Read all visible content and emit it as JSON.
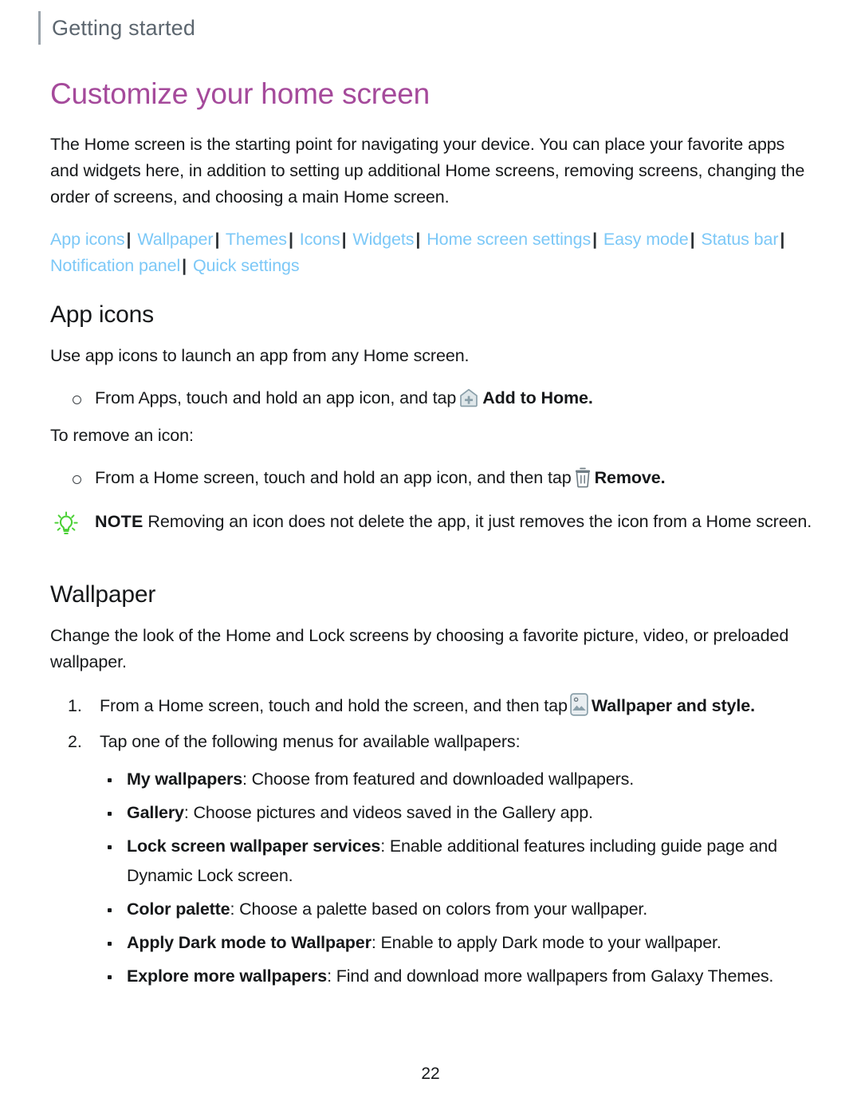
{
  "header": {
    "running_title": "Getting started"
  },
  "page_title": "Customize your home screen",
  "intro": "The Home screen is the starting point for navigating your device. You can place your favorite apps and widgets here, in addition to setting up additional Home screens, removing screens, changing the order of screens, and choosing a main Home screen.",
  "cross_links": [
    "App icons",
    "Wallpaper",
    "Themes",
    "Icons",
    "Widgets",
    "Home screen settings",
    "Easy mode",
    "Status bar",
    "Notification panel",
    "Quick settings"
  ],
  "link_separator": "|",
  "sections": {
    "app_icons": {
      "heading": "App icons",
      "intro": "Use app icons to launch an app from any Home screen.",
      "step_prefix": "From Apps, touch and hold an app icon, and tap",
      "step_icon_label": "add-to-home-icon",
      "step_bold": "Add to Home.",
      "remove_intro": "To remove an icon:",
      "remove_prefix": "From a Home screen, touch and hold an app icon, and then tap",
      "remove_icon_label": "trash-icon",
      "remove_bold": "Remove.",
      "note_word": "NOTE",
      "note_text": "Removing an icon does not delete the app, it just removes the icon from a Home screen."
    },
    "wallpaper": {
      "heading": "Wallpaper",
      "intro": "Change the look of the Home and Lock screens by choosing a favorite picture, video, or preloaded wallpaper.",
      "steps": [
        {
          "prefix": "From a Home screen, touch and hold the screen, and then tap",
          "icon_label": "wallpaper-picture-icon",
          "bold": "Wallpaper and style",
          "suffix": "."
        },
        {
          "prefix": "Tap one of the following menus for available wallpapers:",
          "icon_label": "",
          "bold": "",
          "suffix": ""
        }
      ],
      "menu_items": [
        {
          "term": "My wallpapers",
          "desc": ": Choose from featured and downloaded wallpapers."
        },
        {
          "term": "Gallery",
          "desc": ": Choose pictures and videos saved in the Gallery app."
        },
        {
          "term": "Lock screen wallpaper services",
          "desc": ": Enable additional features including guide page and Dynamic Lock screen."
        },
        {
          "term": "Color palette",
          "desc": ": Choose a palette based on colors from your wallpaper."
        },
        {
          "term": "Apply Dark mode to Wallpaper",
          "desc": ": Enable to apply Dark mode to your wallpaper."
        },
        {
          "term": "Explore more wallpapers",
          "desc": ": Find and download more wallpapers from Galaxy Themes."
        }
      ]
    }
  },
  "page_number": "22",
  "colors": {
    "title_purple": "#a54a9b",
    "link_blue": "#7cc8f7",
    "header_gray": "#5c666f",
    "note_green": "#4cd137",
    "icon_gray_blue": "#8ba0aa",
    "body_black": "#16181a"
  }
}
